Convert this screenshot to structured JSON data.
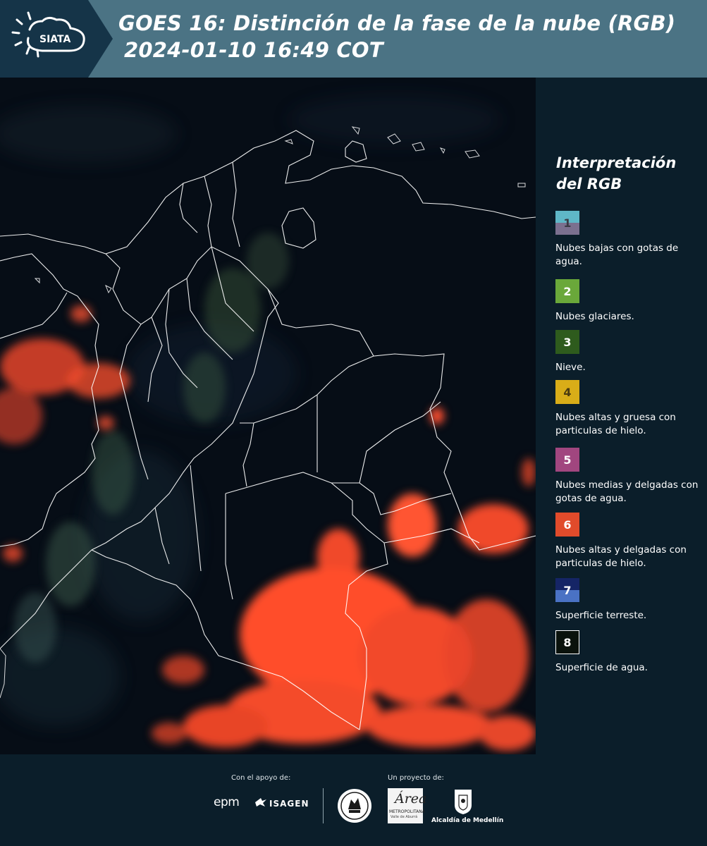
{
  "header": {
    "logo_text": "SIATA",
    "title_line1": "GOES 16: Distinción de la fase de la nube (RGB)",
    "title_line2": "2024-01-10 16:49 COT"
  },
  "legend": {
    "title": "Interpretación del RGB",
    "items": [
      {
        "number": "1",
        "label": "Nubes bajas con gotas de agua.",
        "colors": [
          "#5fb7c7",
          "#7b708f"
        ]
      },
      {
        "number": "2",
        "label": "Nubes glaciares.",
        "colors": [
          "#6aa83a"
        ]
      },
      {
        "number": "3",
        "label": "Nieve.",
        "colors": [
          "#2e5b1d"
        ]
      },
      {
        "number": "4",
        "label": "Nubes altas y gruesa con particulas de hielo.",
        "colors": [
          "#d9ad18"
        ]
      },
      {
        "number": "5",
        "label": "Nubes medias y delgadas con gotas de agua.",
        "colors": [
          "#a1467f"
        ]
      },
      {
        "number": "6",
        "label": "Nubes altas y delgadas con particulas de hielo.",
        "colors": [
          "#e14b2b"
        ]
      },
      {
        "number": "7",
        "label": "Superficie terreste.",
        "colors": [
          "#152566",
          "#4a72c4"
        ]
      },
      {
        "number": "8",
        "label": "Superficie de agua.",
        "colors": [
          "#0a120c"
        ]
      }
    ]
  },
  "footer": {
    "support_label": "Con el apoyo de:",
    "project_label": "Un proyecto de:",
    "epm": "epm",
    "isagen": "ISAGEN",
    "area_letter": "Área",
    "area_line1": "METROPOLITANA",
    "area_line2": "Valle de Aburrá",
    "alcaldia": "Alcaldía de Medellín"
  },
  "colors": {
    "header_bg": "#4b7384",
    "panel_bg": "#0b1e2a",
    "map_bg": "#050c14",
    "cloud_red": "#ff4a2a",
    "border_white": "#ffffff"
  }
}
